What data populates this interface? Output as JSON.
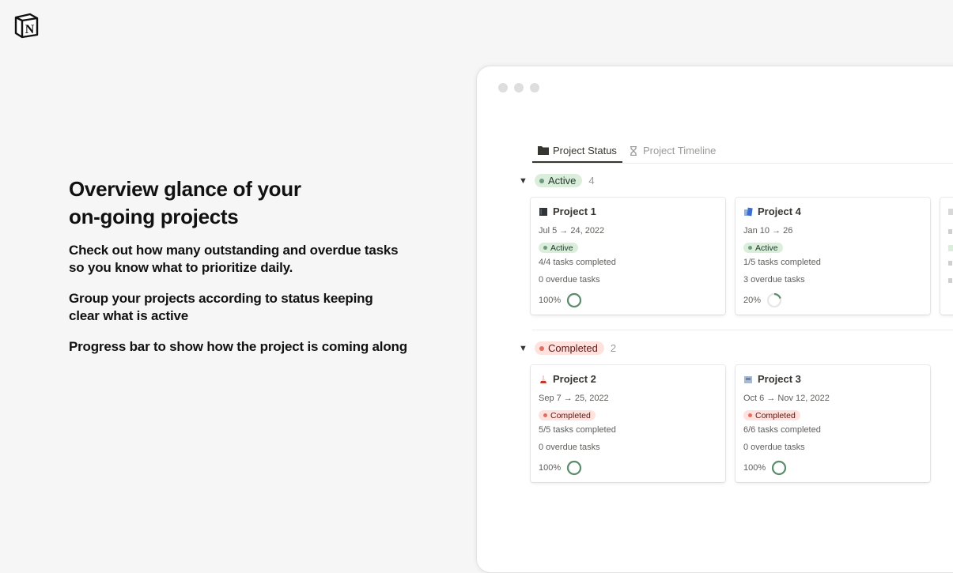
{
  "brand": {
    "logo_icon": "notion-logo-icon"
  },
  "marketing": {
    "headline_line1": "Overview glance of your",
    "headline_line2": "on-going projects",
    "points": [
      {
        "line1": "Check out how many outstanding and overdue tasks",
        "line2": "so you know what to prioritize daily."
      },
      {
        "line1": "Group your projects according to status keeping",
        "line2": "clear what is active"
      },
      {
        "line1": "Progress bar to show how the project is coming along",
        "line2": ""
      }
    ]
  },
  "window": {
    "tabs": [
      {
        "label": "Project Status",
        "icon": "folder-icon",
        "active": true
      },
      {
        "label": "Project Timeline",
        "icon": "hourglass-icon",
        "active": false
      }
    ],
    "groups": [
      {
        "status": "Active",
        "count": "4",
        "color": "#6c9b7d",
        "cards": [
          {
            "icon": "book-icon",
            "icon_color": "#2f3437",
            "title": "Project 1",
            "dates": "Jul 5 → 24, 2022",
            "status": "Active",
            "tasks": "4/4 tasks completed",
            "overdue": "0 overdue tasks",
            "progress_label": "100%",
            "progress": 1.0
          },
          {
            "icon": "blue-books-icon",
            "icon_color": "#4a7fd4",
            "title": "Project 4",
            "dates": "Jan 10 → 26",
            "status": "Active",
            "tasks": "1/5 tasks completed",
            "overdue": "3 overdue tasks",
            "progress_label": "20%",
            "progress": 0.2
          },
          {
            "icon": "project-icon",
            "icon_color": "#9b9a97",
            "title": "",
            "dates": "",
            "status": "Active",
            "tasks": "",
            "overdue": "",
            "progress_label": "",
            "progress": 0
          }
        ]
      },
      {
        "status": "Completed",
        "count": "2",
        "color": "#e16f64",
        "cards": [
          {
            "icon": "flask-icon",
            "icon_color": "#c0392b",
            "title": "Project 2",
            "dates": "Sep 7 → 25, 2022",
            "status": "Completed",
            "tasks": "5/5 tasks completed",
            "overdue": "0 overdue tasks",
            "progress_label": "100%",
            "progress": 1.0
          },
          {
            "icon": "mailbox-icon",
            "icon_color": "#7d93b2",
            "title": "Project 3",
            "dates": "Oct 6 → Nov 12, 2022",
            "status": "Completed",
            "tasks": "6/6 tasks completed",
            "overdue": "0 overdue tasks",
            "progress_label": "100%",
            "progress": 1.0
          }
        ]
      }
    ]
  }
}
